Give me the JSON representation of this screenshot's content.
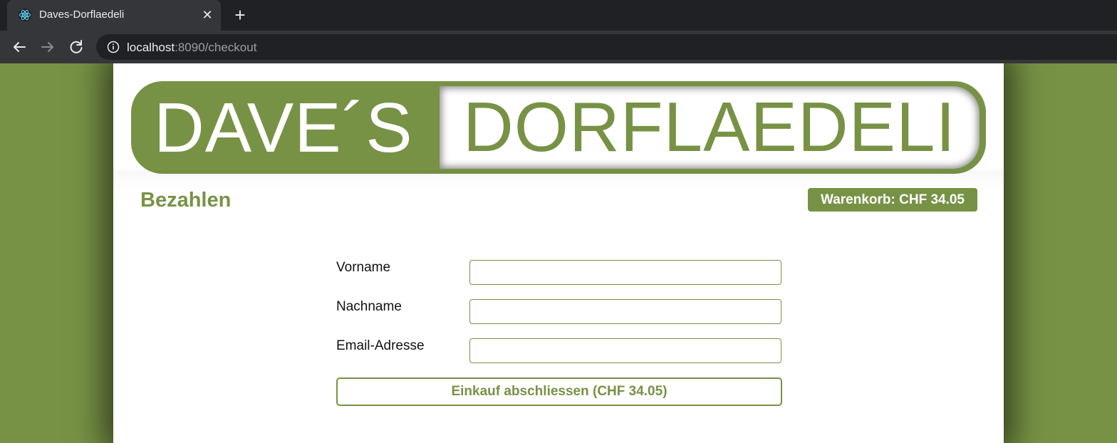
{
  "browser": {
    "tab_title": "Daves-Dorflaedeli",
    "tab_close_glyph": "✕",
    "new_tab_glyph": "+",
    "url_host": "localhost",
    "url_rest": ":8090/checkout",
    "icons": {
      "favicon": "react-atom-icon",
      "back": "arrow-left-icon",
      "forward": "arrow-right-icon",
      "reload": "reload-icon",
      "info": "info-circle-icon"
    }
  },
  "banner": {
    "left_text": "DAVE´S",
    "right_text": "DORFLAEDELI"
  },
  "page": {
    "title": "Bezahlen",
    "cart_badge": "Warenkorb: CHF 34.05"
  },
  "form": {
    "fields": [
      {
        "label": "Vorname",
        "value": "",
        "placeholder": ""
      },
      {
        "label": "Nachname",
        "value": "",
        "placeholder": ""
      },
      {
        "label": "Email-Adresse",
        "value": "",
        "placeholder": ""
      }
    ],
    "submit_label": "Einkauf abschliessen (CHF 34.05)"
  },
  "colors": {
    "brand_green": "#779245",
    "chrome_dark": "#202124",
    "chrome_tab": "#35363a"
  }
}
